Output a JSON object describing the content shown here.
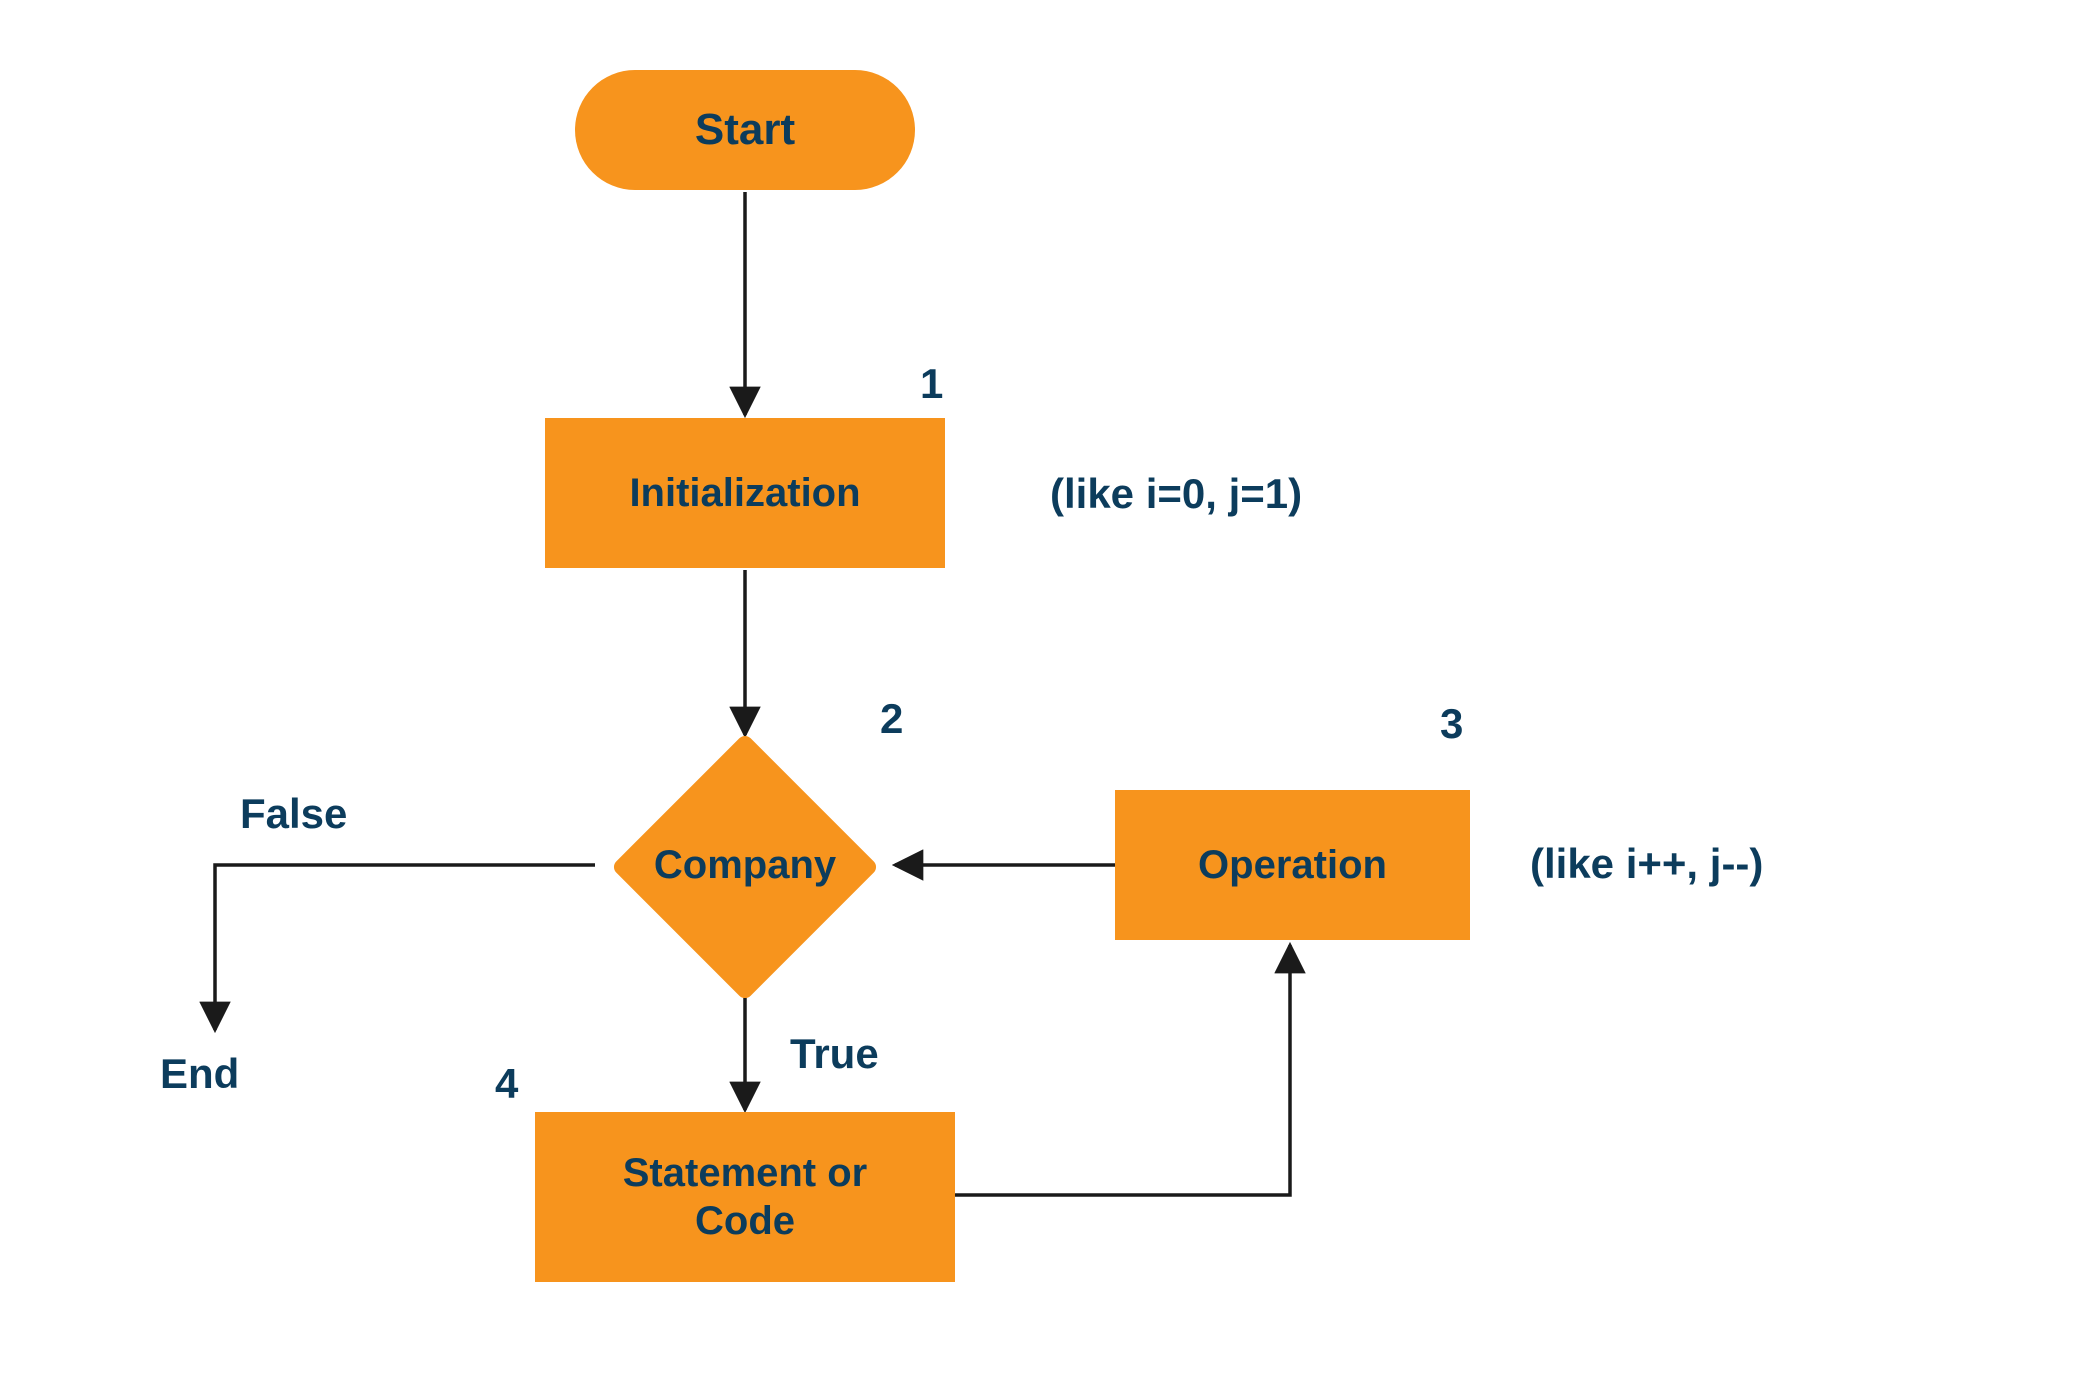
{
  "colors": {
    "accent": "#f7941d",
    "text": "#0c3c5c",
    "edge": "#1a1a1a"
  },
  "nodes": {
    "start": {
      "label": "Start"
    },
    "init": {
      "label": "Initialization",
      "number": "1",
      "annotation": "(like i=0, j=1)"
    },
    "decision": {
      "label": "Company",
      "number": "2"
    },
    "operation": {
      "label": "Operation",
      "number": "3",
      "annotation": "(like i++, j--)"
    },
    "statement": {
      "label": "Statement or\nCode",
      "number": "4"
    }
  },
  "edges": {
    "false_label": "False",
    "true_label": "True",
    "end_label": "End"
  }
}
